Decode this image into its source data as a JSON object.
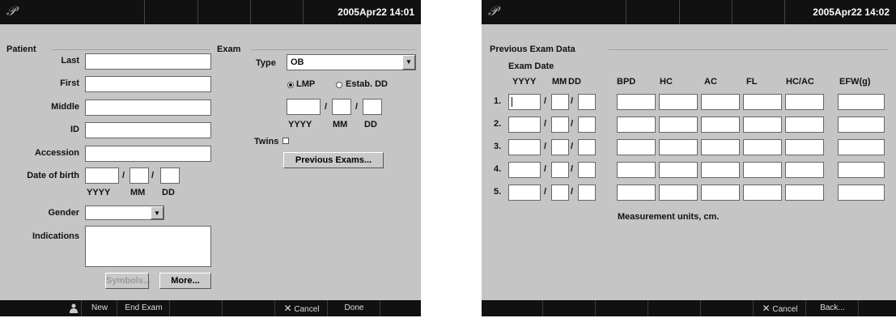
{
  "left": {
    "logo": "𝒫",
    "datetime": "2005Apr22  14:01",
    "patient": {
      "section": "Patient",
      "last": "Last",
      "first": "First",
      "middle": "Middle",
      "id": "ID",
      "accession": "Accession",
      "dob": "Date of birth",
      "slash": "/",
      "yyyy": "YYYY",
      "mm": "MM",
      "dd": "DD",
      "gender": "Gender",
      "indications": "Indications",
      "symbols_btn": "Symbols...",
      "more_btn": "More..."
    },
    "exam": {
      "section": "Exam",
      "type_label": "Type",
      "type_value": "OB",
      "lmp": "LMP",
      "estab_dd": "Estab. DD",
      "yyyy": "YYYY",
      "mm": "MM",
      "dd": "DD",
      "twins": "Twins",
      "prev_btn": "Previous Exams..."
    },
    "bottombar": {
      "new": "New",
      "end_exam": "End Exam",
      "cancel": "Cancel",
      "done": "Done"
    }
  },
  "right": {
    "logo": "𝒫",
    "datetime": "2005Apr22  14:02",
    "title": "Previous Exam Data",
    "exam_date": "Exam Date",
    "headers": [
      "YYYY",
      "MM",
      "DD",
      "BPD",
      "HC",
      "AC",
      "FL",
      "HC/AC",
      "EFW(g)"
    ],
    "rows": [
      "1.",
      "2.",
      "3.",
      "4.",
      "5."
    ],
    "slash": "/",
    "units_note": "Measurement units, cm.",
    "bottombar": {
      "cancel": "Cancel",
      "back": "Back..."
    }
  }
}
